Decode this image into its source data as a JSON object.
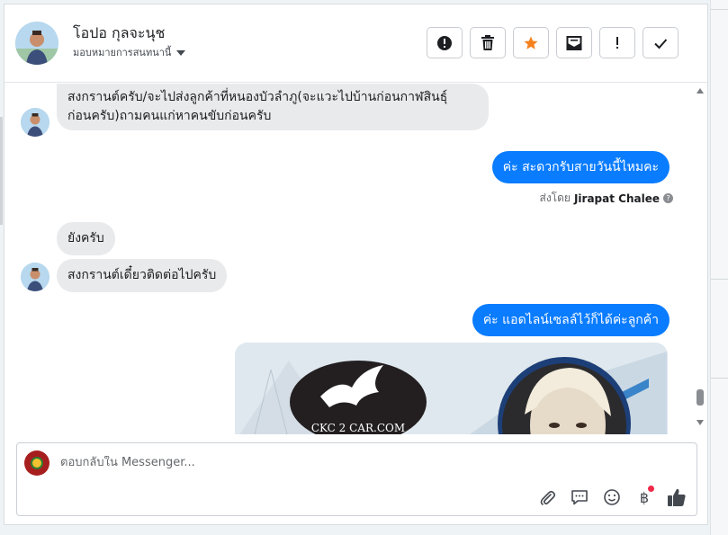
{
  "header": {
    "contact_name": "โอปอ กุลจะนุช",
    "assign_label": "มอบหมายการสนทนานี้",
    "actions": [
      {
        "name": "report-spam",
        "icon": "alert-circle-icon"
      },
      {
        "name": "delete",
        "icon": "trash-icon"
      },
      {
        "name": "star",
        "icon": "star-icon",
        "color": "#f5821f"
      },
      {
        "name": "mark-unread",
        "icon": "envelope-icon"
      },
      {
        "name": "follow-up",
        "icon": "exclamation-icon"
      },
      {
        "name": "done",
        "icon": "check-icon"
      }
    ]
  },
  "messages": [
    {
      "direction": "in",
      "lines": [
        "สงกรานต์ครับ/จะไปส่งลูกค้าที่หนองบัวลำภู(จะแวะไปบ้านก่อนกาฬสินธุ์",
        "ก่อนครับ)ถามคนแก่หาคนขับก่อนครับ"
      ]
    },
    {
      "direction": "out",
      "text": "ค่ะ สะดวกรับสายวันนี้ไหมคะ"
    },
    {
      "direction": "meta",
      "prefix": "ส่งโดย",
      "sender": "Jirapat Chalee"
    },
    {
      "direction": "in",
      "text": "ยังครับ"
    },
    {
      "direction": "in",
      "text": "สงกรานต์เดี๋ยวติดต่อไปครับ"
    },
    {
      "direction": "out",
      "text": "ค่ะ แอดไลน์เซลล์ไว้ก็ได้ค่ะลูกค้า"
    },
    {
      "direction": "out-image",
      "logo_text": "CKC 2 CAR.COM"
    }
  ],
  "composer": {
    "placeholder": "ตอบกลับใน Messenger...",
    "value": "",
    "tools": [
      "paperclip-icon",
      "saved-reply-icon",
      "emoji-icon",
      "baht-icon",
      "like-icon"
    ],
    "currency_symbol": "฿"
  },
  "colors": {
    "accent": "#0a7cff",
    "incoming_bubble": "#e9eaec",
    "notification": "#f02849"
  }
}
